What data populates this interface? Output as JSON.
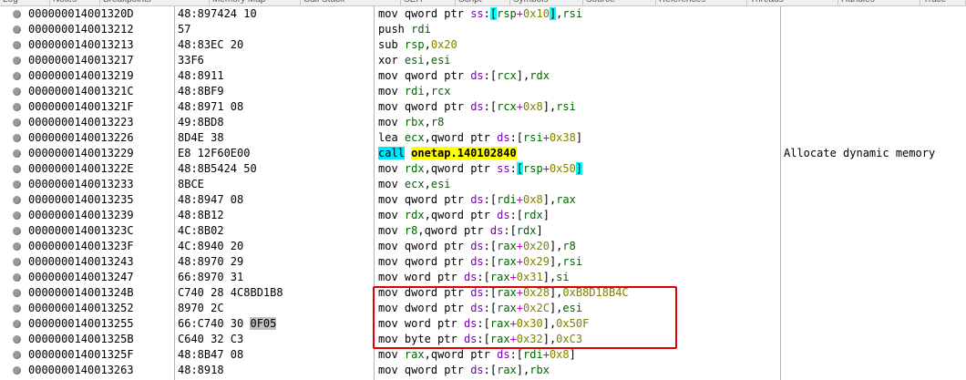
{
  "tabs": [
    "Log",
    "Notes",
    "Breakpoints",
    "Memory Map",
    "Call Stack",
    "SEH",
    "Script",
    "Symbols",
    "Source",
    "References",
    "Threads",
    "Handles",
    "Trace"
  ],
  "colors": {
    "highlight_box": "#e00000",
    "call_bg": "#00e5ff",
    "label_bg": "#ffff00",
    "breakpoint_dot": "#9a9a9a"
  },
  "rows": [
    {
      "addr": "000000014001320D",
      "bytes": "48:897424 10",
      "instr": "mov qword ptr ss:[rsp+0x10],rsi",
      "comment": ""
    },
    {
      "addr": "0000000140013212",
      "bytes": "57",
      "instr": "push rdi",
      "comment": ""
    },
    {
      "addr": "0000000140013213",
      "bytes": "48:83EC 20",
      "instr": "sub rsp,0x20",
      "comment": ""
    },
    {
      "addr": "0000000140013217",
      "bytes": "33F6",
      "instr": "xor esi,esi",
      "comment": ""
    },
    {
      "addr": "0000000140013219",
      "bytes": "48:8911",
      "instr": "mov qword ptr ds:[rcx],rdx",
      "comment": ""
    },
    {
      "addr": "000000014001321C",
      "bytes": "48:8BF9",
      "instr": "mov rdi,rcx",
      "comment": ""
    },
    {
      "addr": "000000014001321F",
      "bytes": "48:8971 08",
      "instr": "mov qword ptr ds:[rcx+0x8],rsi",
      "comment": ""
    },
    {
      "addr": "0000000140013223",
      "bytes": "49:8BD8",
      "instr": "mov rbx,r8",
      "comment": ""
    },
    {
      "addr": "0000000140013226",
      "bytes": "8D4E 38",
      "instr": "lea ecx,qword ptr ds:[rsi+0x38]",
      "comment": ""
    },
    {
      "addr": "0000000140013229",
      "bytes": "E8 12F60E00",
      "instr": "call onetap.140102840",
      "comment": "Allocate dynamic memory"
    },
    {
      "addr": "000000014001322E",
      "bytes": "48:8B5424 50",
      "instr": "mov rdx,qword ptr ss:[rsp+0x50]",
      "comment": ""
    },
    {
      "addr": "0000000140013233",
      "bytes": "8BCE",
      "instr": "mov ecx,esi",
      "comment": ""
    },
    {
      "addr": "0000000140013235",
      "bytes": "48:8947 08",
      "instr": "mov qword ptr ds:[rdi+0x8],rax",
      "comment": ""
    },
    {
      "addr": "0000000140013239",
      "bytes": "48:8B12",
      "instr": "mov rdx,qword ptr ds:[rdx]",
      "comment": ""
    },
    {
      "addr": "000000014001323C",
      "bytes": "4C:8B02",
      "instr": "mov r8,qword ptr ds:[rdx]",
      "comment": ""
    },
    {
      "addr": "000000014001323F",
      "bytes": "4C:8940 20",
      "instr": "mov qword ptr ds:[rax+0x20],r8",
      "comment": ""
    },
    {
      "addr": "0000000140013243",
      "bytes": "48:8970 29",
      "instr": "mov qword ptr ds:[rax+0x29],rsi",
      "comment": ""
    },
    {
      "addr": "0000000140013247",
      "bytes": "66:8970 31",
      "instr": "mov word ptr ds:[rax+0x31],si",
      "comment": ""
    },
    {
      "addr": "000000014001324B",
      "bytes": "C740 28 4C8BD1B8",
      "instr": "mov dword ptr ds:[rax+0x28],0xB8D18B4C",
      "comment": ""
    },
    {
      "addr": "0000000140013252",
      "bytes": "8970 2C",
      "instr": "mov dword ptr ds:[rax+0x2C],esi",
      "comment": ""
    },
    {
      "addr": "0000000140013255",
      "bytes": "66:C740 30 0F05",
      "instr": "mov word ptr ds:[rax+0x30],0x50F",
      "comment": "",
      "bytes_highlight": "0F05"
    },
    {
      "addr": "000000014001325B",
      "bytes": "C640 32 C3",
      "instr": "mov byte ptr ds:[rax+0x32],0xC3",
      "comment": ""
    },
    {
      "addr": "000000014001325F",
      "bytes": "48:8B47 08",
      "instr": "mov rax,qword ptr ds:[rdi+0x8]",
      "comment": ""
    },
    {
      "addr": "0000000140013263",
      "bytes": "48:8918",
      "instr": "mov qword ptr ds:[rax],rbx",
      "comment": ""
    }
  ]
}
